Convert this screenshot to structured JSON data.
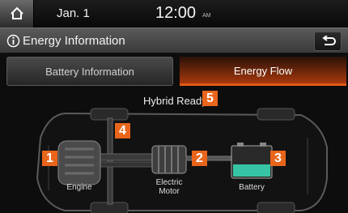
{
  "status_bar": {
    "home_icon": "home-icon",
    "date": "Jan.  1",
    "time": "12:00",
    "ampm": "AM"
  },
  "title_bar": {
    "info_icon": "info-icon",
    "title": "Energy Information",
    "back_icon": "back-arrow-icon"
  },
  "tabs": [
    {
      "label": "Battery Information",
      "active": false
    },
    {
      "label": "Energy Flow",
      "active": true
    }
  ],
  "diagram": {
    "status": "Hybrid Ready",
    "badges": [
      "1",
      "2",
      "3",
      "4",
      "5"
    ],
    "labels": {
      "engine": "Engine",
      "motor_line1": "Electric",
      "motor_line2": "Motor",
      "battery": "Battery"
    }
  },
  "colors": {
    "accent": "#e9651c",
    "active_tab": "#a8380c",
    "battery_fill": "#36c4a4"
  }
}
